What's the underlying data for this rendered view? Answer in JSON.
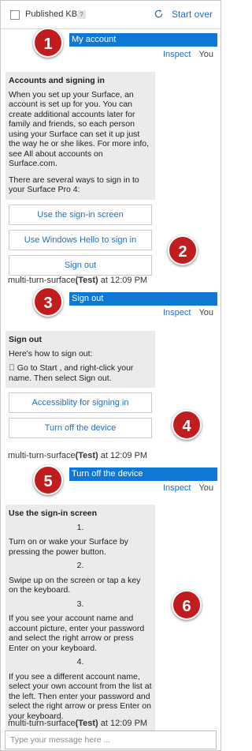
{
  "topbar": {
    "published_label": "Published KB",
    "help_icon": "?",
    "start_over": "Start over"
  },
  "messages": {
    "m1": {
      "text": "My account",
      "inspect": "Inspect",
      "you": "You"
    },
    "m3": {
      "text": "Sign out",
      "inspect": "Inspect",
      "you": "You"
    },
    "m5": {
      "text": "Turn off the device",
      "inspect": "Inspect",
      "you": "You"
    }
  },
  "cards": {
    "c1": {
      "title": "Accounts and signing in",
      "p1": "When you set up your Surface, an account is set up for you. You can create additional accounts later for family and friends, so each person using your Surface can set it up just the way he or she likes. For more info, see All about accounts on Surface.com.",
      "p2": "There are several ways to sign in to your Surface Pro 4:",
      "buttons": [
        "Use the sign-in screen",
        "Use Windows Hello to sign in",
        "Sign out"
      ]
    },
    "c2": {
      "title": "Sign out",
      "p1": "Here's how to sign out:",
      "p2": " Go to Start , and right-click your name. Then select Sign out.",
      "buttons": [
        "Accessiblity for signing in",
        "Turn off the device"
      ]
    },
    "c3": {
      "title": "Use the sign-in screen",
      "steps": [
        {
          "num": "1.",
          "text": "Turn on or wake your Surface by pressing the power button."
        },
        {
          "num": "2.",
          "text": "Swipe up on the screen or tap a key on the keyboard."
        },
        {
          "num": "3.",
          "text": "If you see your account name and account picture, enter your password and select the right arrow or press Enter on your keyboard."
        },
        {
          "num": "4.",
          "text": "If you see a different account name, select your own account from the list at the left. Then enter your password and select the right arrow or press Enter on your keyboard."
        }
      ]
    }
  },
  "sender": {
    "name": "multi-turn-surface",
    "tag": "(Test)",
    "time": " at 12:09 PM"
  },
  "markers": [
    "1",
    "2",
    "3",
    "4",
    "5",
    "6"
  ],
  "input": {
    "placeholder": "Type your message here ..."
  },
  "colors": {
    "accent": "#0e78d4",
    "link": "#1f6fc2",
    "marker": "#c01e1e",
    "card_bg": "#ebebeb"
  }
}
